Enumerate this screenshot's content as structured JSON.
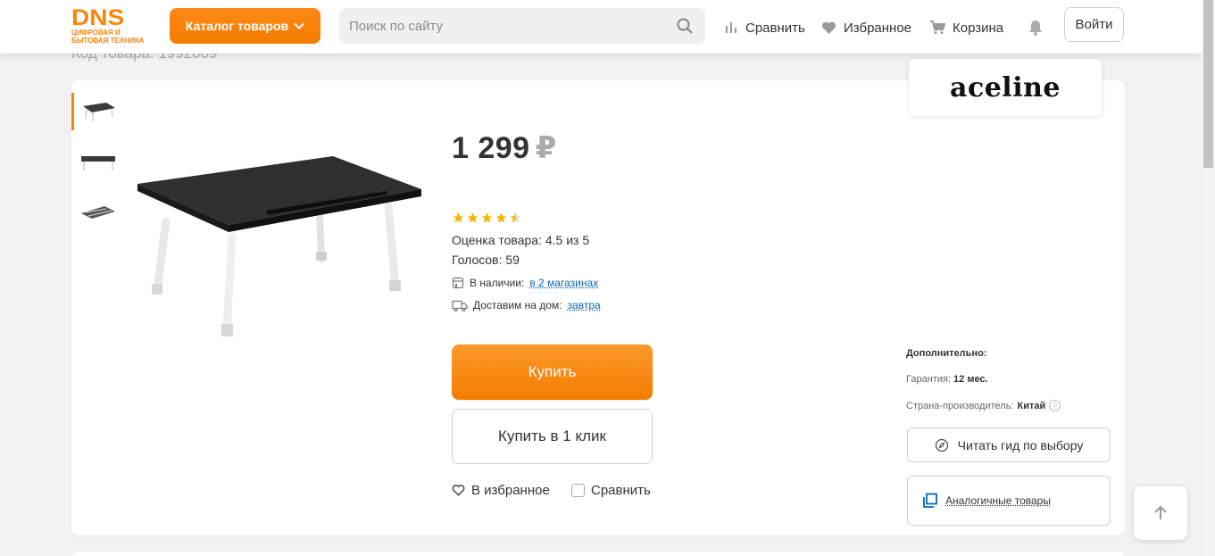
{
  "header": {
    "logo_text": "DNS",
    "logo_subtitle": "ЦИФРОВАЯ И БЫТОВАЯ ТЕХНИКА",
    "catalog_label": "Каталог товаров",
    "search_placeholder": "Поиск по сайту",
    "compare_label": "Сравнить",
    "favorites_label": "Избранное",
    "cart_label": "Корзина",
    "login_label": "Войти"
  },
  "product": {
    "code_text": "Код товара: 1992009",
    "price": "1 299",
    "currency": "₽",
    "rating_value": 4.5,
    "rating_text": "Оценка товара: 4.5 из 5",
    "votes_text": "Голосов: 59",
    "availability_label": "В наличии:",
    "availability_link": "в 2 магазинах",
    "delivery_label": "Доставим на дом:",
    "delivery_link": "завтра",
    "buy_label": "Купить",
    "oneclick_label": "Купить в 1 клик",
    "favorite_label": "В избранное",
    "compare_label": "Сравнить"
  },
  "sidebar": {
    "brand": "aceline",
    "extra_title": "Дополнительно:",
    "warranty_label": "Гарантия:",
    "warranty_value": "12 мес.",
    "country_label": "Страна-производитель:",
    "country_value": "Китай",
    "guide_label": "Читать гид по выбору",
    "similar_label": "Аналогичные товары"
  },
  "colors": {
    "accent": "#fc8507",
    "link": "#0a67b1",
    "star": "#f7b500"
  }
}
